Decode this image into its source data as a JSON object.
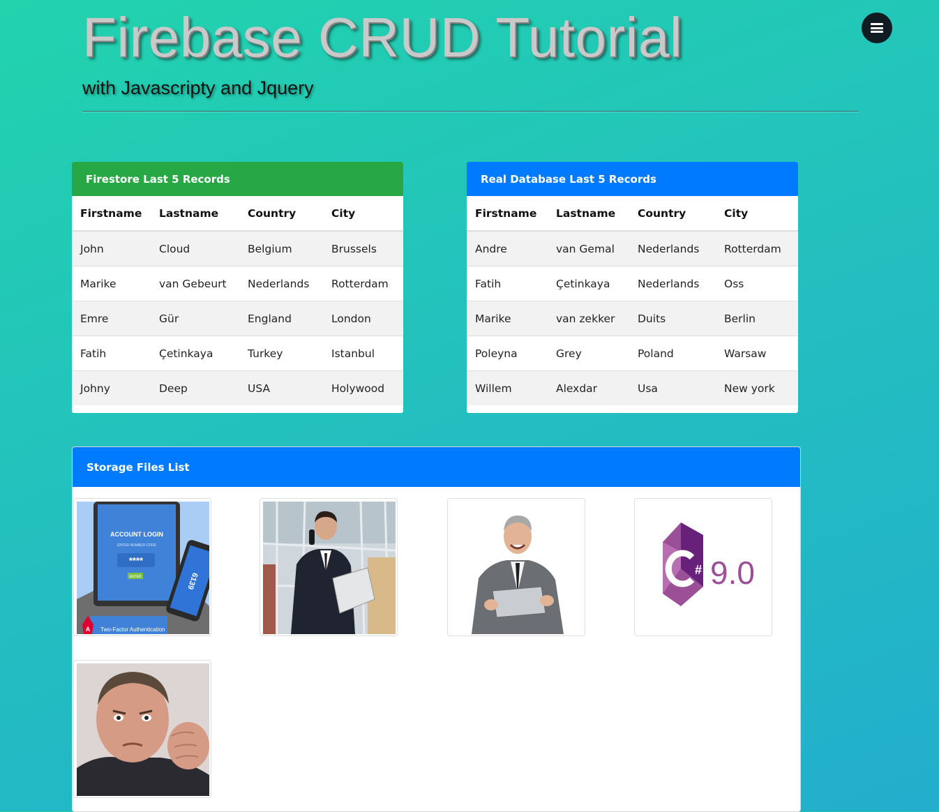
{
  "header": {
    "title": "Firebase CRUD Tutorial",
    "subtitle": "with Javascripty and Jquery",
    "menu_icon": "hamburger-menu-icon"
  },
  "firestore": {
    "title": "Firestore Last 5 Records",
    "header_color": "#28a745",
    "columns": [
      "Firstname",
      "Lastname",
      "Country",
      "City"
    ],
    "rows": [
      [
        "John",
        "Cloud",
        "Belgium",
        "Brussels"
      ],
      [
        "Marike",
        "van Gebeurt",
        "Nederlands",
        "Rotterdam"
      ],
      [
        "Emre",
        "Gür",
        "England",
        "London"
      ],
      [
        "Fatih",
        "Çetinkaya",
        "Turkey",
        "Istanbul"
      ],
      [
        "Johny",
        "Deep",
        "USA",
        "Holywood"
      ]
    ]
  },
  "realtime": {
    "title": "Real Database Last 5 Records",
    "header_color": "#007bff",
    "columns": [
      "Firstname",
      "Lastname",
      "Country",
      "City"
    ],
    "rows": [
      [
        "Andre",
        "van Gemal",
        "Nederlands",
        "Rotterdam"
      ],
      [
        "Fatih",
        "Çetinkaya",
        "Nederlands",
        "Oss"
      ],
      [
        "Marike",
        "van zekker",
        "Duits",
        "Berlin"
      ],
      [
        "Poleyna",
        "Grey",
        "Poland",
        "Warsaw"
      ],
      [
        "Willem",
        "Alexdar",
        "Usa",
        "New york"
      ]
    ]
  },
  "storage": {
    "title": "Storage Files List",
    "header_color": "#007bff",
    "login_image_text": {
      "heading": "ACCOUNT LOGIN",
      "subheading": "ENTER NUMBER CODE",
      "code": "****",
      "enter": "ENTER",
      "phone_code": "6139",
      "caption": "Two-Factor Authentication"
    },
    "csharp_image_text": {
      "symbol": "#",
      "version": "9.0"
    }
  }
}
